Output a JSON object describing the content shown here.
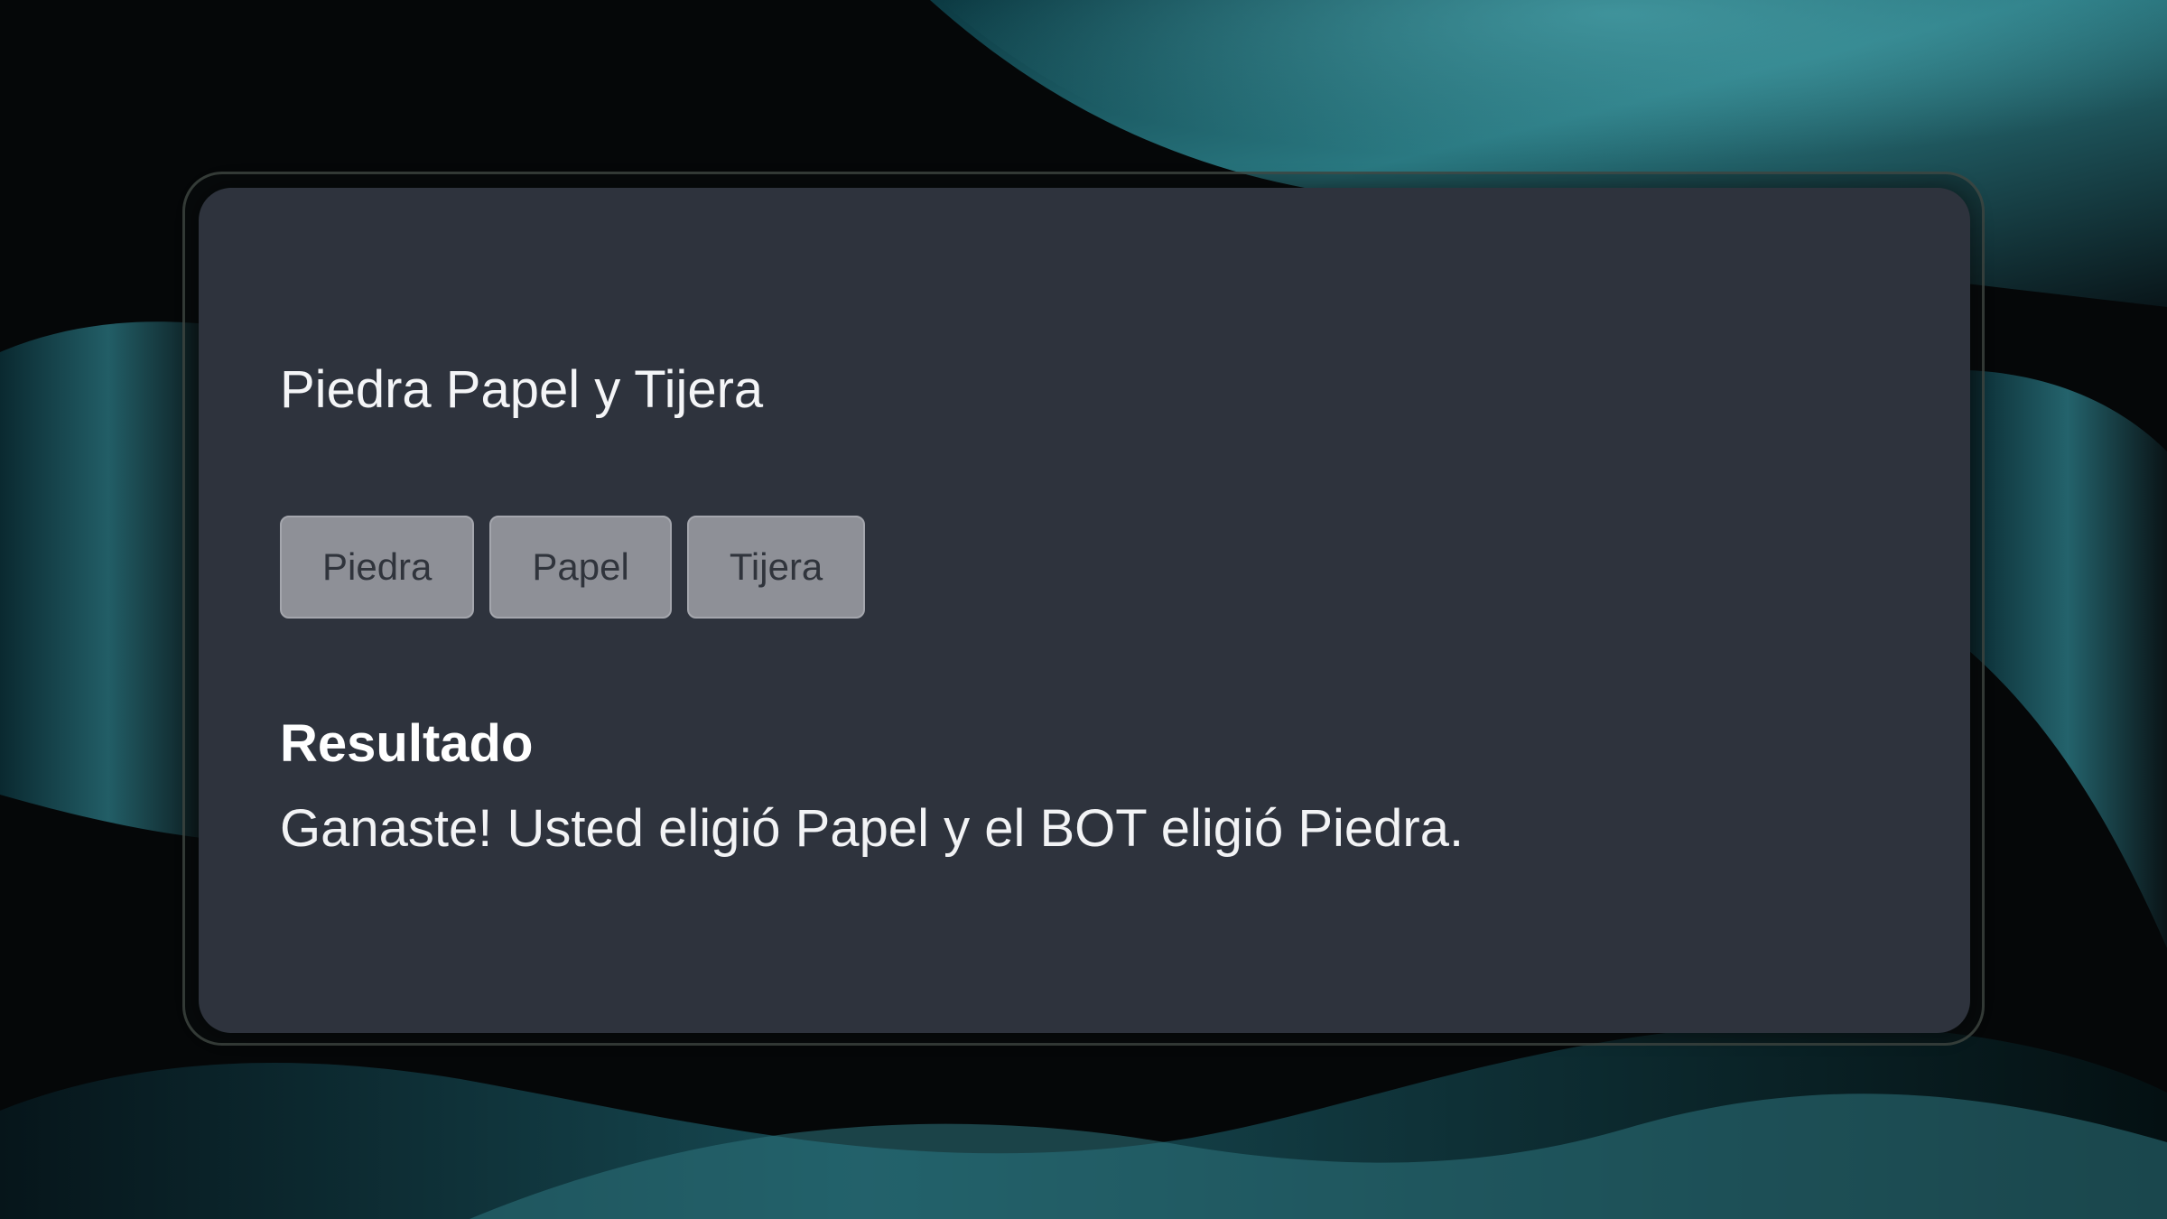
{
  "colors": {
    "card_background": "#2e333d",
    "button_background": "#8e9097",
    "button_text": "#30343c",
    "text": "#f4f5f7",
    "wallpaper_accent": "#2a7f88",
    "wallpaper_dark": "#050708"
  },
  "game": {
    "title": "Piedra Papel y Tijera",
    "buttons": [
      {
        "label": "Piedra"
      },
      {
        "label": "Papel"
      },
      {
        "label": "Tijera"
      }
    ]
  },
  "result": {
    "heading": "Resultado",
    "message": "Ganaste! Usted eligió Papel y el BOT eligió Piedra."
  }
}
